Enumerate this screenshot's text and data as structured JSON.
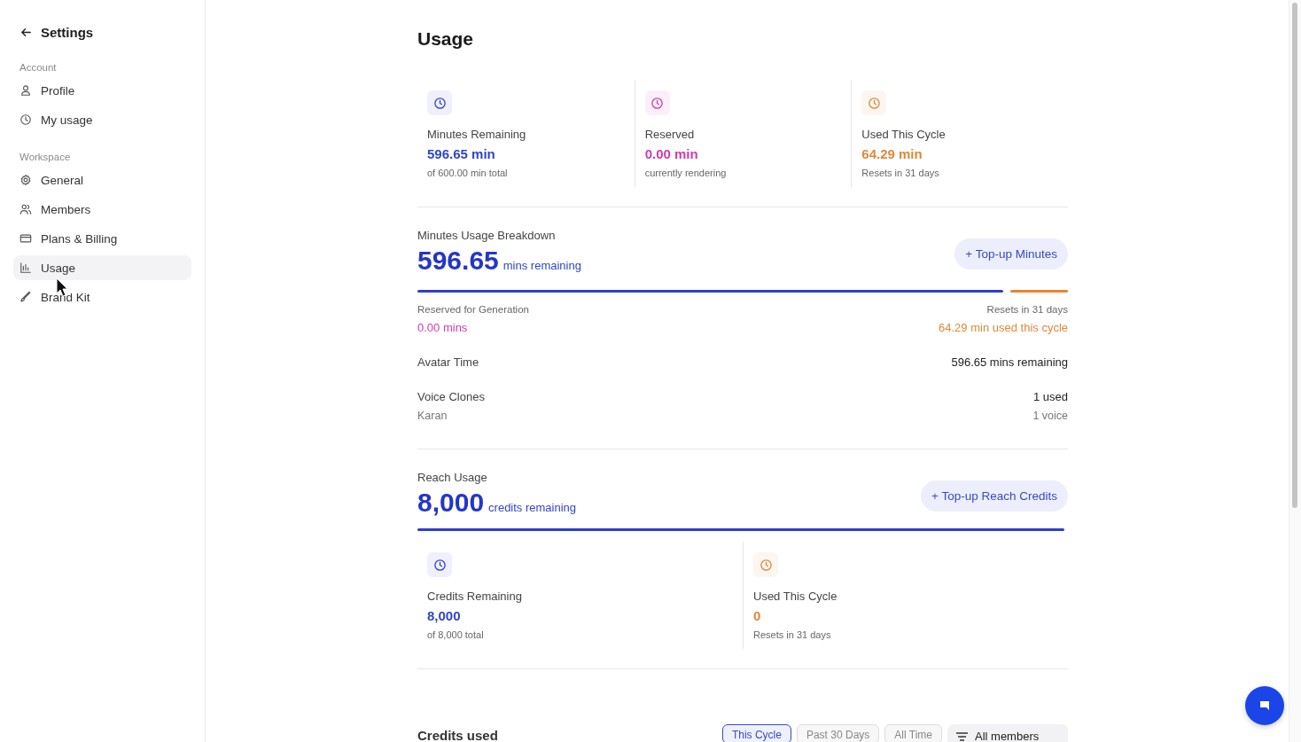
{
  "sidebar": {
    "back_label": "Settings",
    "sections": [
      {
        "heading": "Account",
        "items": [
          {
            "label": "Profile",
            "kind": "user",
            "selected": false
          },
          {
            "label": "My usage",
            "kind": "clock",
            "selected": false
          }
        ]
      },
      {
        "heading": "Workspace",
        "items": [
          {
            "label": "General",
            "kind": "gear",
            "selected": false
          },
          {
            "label": "Members",
            "kind": "users",
            "selected": false
          },
          {
            "label": "Plans & Billing",
            "kind": "card",
            "selected": false
          },
          {
            "label": "Usage",
            "kind": "chart",
            "selected": true
          },
          {
            "label": "Brand Kit",
            "kind": "brush",
            "selected": false
          }
        ]
      }
    ]
  },
  "page_title": "Usage",
  "stats": [
    {
      "label": "Minutes Remaining",
      "value": "596.65 min",
      "sub": "of 600.00 min total",
      "color": "#2f45c8"
    },
    {
      "label": "Reserved",
      "value": "0.00 min",
      "sub": "currently rendering",
      "color": "#d03cae"
    },
    {
      "label": "Used This Cycle",
      "value": "64.29 min",
      "sub": "Resets in 31 days",
      "color": "#e0883a"
    }
  ],
  "minutes_breakdown": {
    "title": "Minutes Usage Breakdown",
    "big_value": "596.65",
    "big_unit": "mins remaining",
    "button": "+ Top-up Minutes",
    "level": 0.9,
    "left_label": "Reserved for Generation",
    "left_value": "0.00 mins",
    "right_label": "Resets in 31 days",
    "right_value": "64.29 min used this cycle",
    "rows": [
      {
        "label": "Avatar Time",
        "value": "596.65 mins remaining"
      },
      {
        "label": "Voice Clones",
        "sub": "Karan",
        "value": "1 used",
        "value_sub": "1 voice"
      }
    ]
  },
  "reach": {
    "title": "Reach Usage",
    "big_value": "8,000",
    "big_unit": "credits remaining",
    "button": "+ Top-up Reach Credits",
    "level": 1,
    "stats": [
      {
        "label": "Credits Remaining",
        "value": "8,000",
        "sub": "of 8,000 total",
        "color": "#2f45c8"
      },
      {
        "label": "Used This Cycle",
        "value": "0",
        "sub": "Resets in 31 days",
        "color": "#e0883a"
      }
    ]
  },
  "credits_used": {
    "title": "Credits used",
    "filters": [
      {
        "label": "This Cycle",
        "selected": true
      },
      {
        "label": "Past 30 Days",
        "selected": false
      },
      {
        "label": "All Time",
        "selected": false
      }
    ],
    "members_filter": "All members"
  }
}
